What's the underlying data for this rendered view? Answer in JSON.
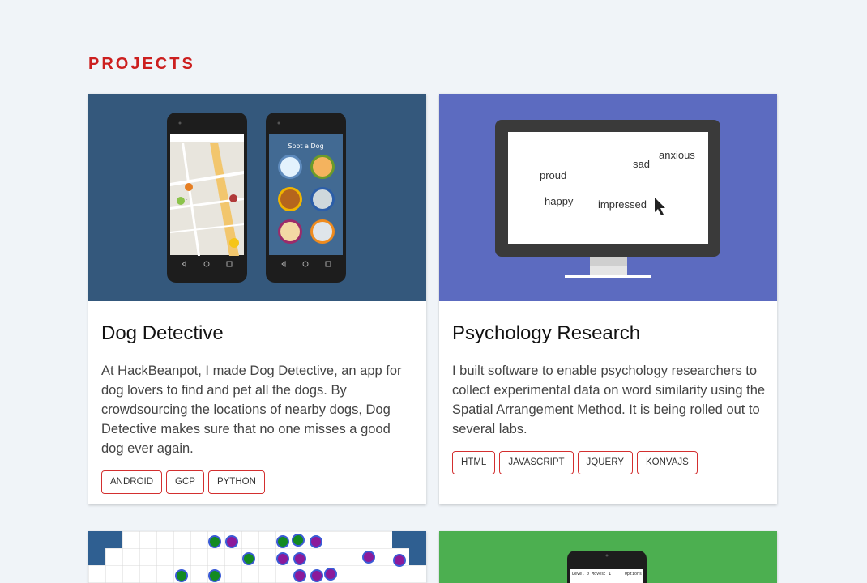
{
  "section": {
    "title": "PROJECTS"
  },
  "projects": [
    {
      "title": "Dog Detective",
      "description": "At HackBeanpot, I made Dog Detective, an app for dog lovers to find and pet all the dogs. By crowdsourcing the locations of nearby dogs, Dog Detective makes sure that no one misses a good dog ever again.",
      "tags": [
        "ANDROID",
        "GCP",
        "PYTHON"
      ],
      "image": {
        "bg": "#34587c",
        "phone_screen_title": "Spot a Dog"
      }
    },
    {
      "title": "Psychology Research",
      "description": "I built software to enable psychology researchers to collect experimental data on word similarity using the Spatial Arrangement Method. It is being rolled out to several labs.",
      "tags": [
        "HTML",
        "JAVASCRIPT",
        "JQUERY",
        "KONVAJS"
      ],
      "image": {
        "bg": "#5c6bc0",
        "words": [
          "proud",
          "sad",
          "anxious",
          "happy",
          "impressed"
        ]
      }
    }
  ],
  "partial_cards": [
    {
      "bg": "#ffffff",
      "hud_left": "Level 0  Moves: 1",
      "hud_right": "Options"
    },
    {
      "bg": "#4caf50"
    }
  ],
  "colors": {
    "accent": "#cc1f1f",
    "tag_border": "#d32f2f"
  }
}
